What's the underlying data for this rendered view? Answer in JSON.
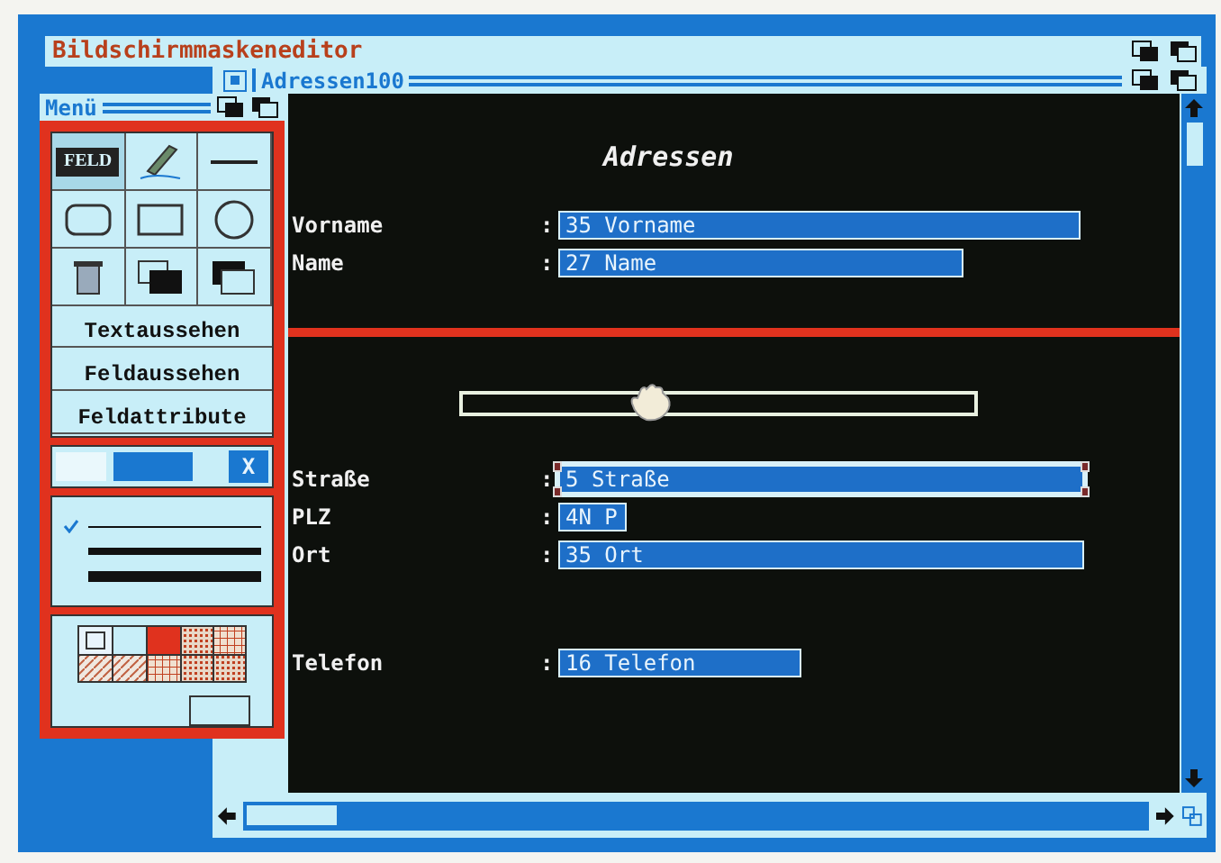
{
  "app_title": "Bildschirmmaskeneditor",
  "window": {
    "title": "Adressen100"
  },
  "menu": {
    "title": "Menü",
    "tools": [
      {
        "kind": "field",
        "label": "FELD",
        "selected": true
      },
      {
        "kind": "pen",
        "selected": false
      },
      {
        "kind": "line",
        "selected": false
      },
      {
        "kind": "rounded-rect",
        "selected": false
      },
      {
        "kind": "rect",
        "selected": false
      },
      {
        "kind": "ellipse",
        "selected": false
      },
      {
        "kind": "trash",
        "selected": false
      },
      {
        "kind": "to-back",
        "selected": false
      },
      {
        "kind": "to-front",
        "selected": false
      }
    ],
    "items": [
      "Textaussehen",
      "Feldaussehen",
      "Feldattribute"
    ],
    "close_label": "X",
    "line_styles": [
      {
        "selected": true
      },
      {
        "selected": false
      },
      {
        "selected": false
      }
    ]
  },
  "form": {
    "heading": "Adressen",
    "groups": [
      {
        "rows": [
          {
            "label": "Vorname",
            "colon": ":",
            "value": "35 Vorname",
            "selected": false
          },
          {
            "label": "Name",
            "colon": ":",
            "value": "27 Name",
            "selected": false
          }
        ]
      },
      {
        "rows": [
          {
            "label": "Straße",
            "colon": ":",
            "value": "5 Straße",
            "selected": true
          },
          {
            "label": "PLZ",
            "colon": ":",
            "value": "4N P",
            "selected": false
          },
          {
            "label": "Ort",
            "colon": ":",
            "value": "35 Ort",
            "selected": false
          }
        ]
      },
      {
        "rows": [
          {
            "label": "Telefon",
            "colon": ":",
            "value": "16 Telefon",
            "selected": false
          }
        ]
      }
    ]
  }
}
